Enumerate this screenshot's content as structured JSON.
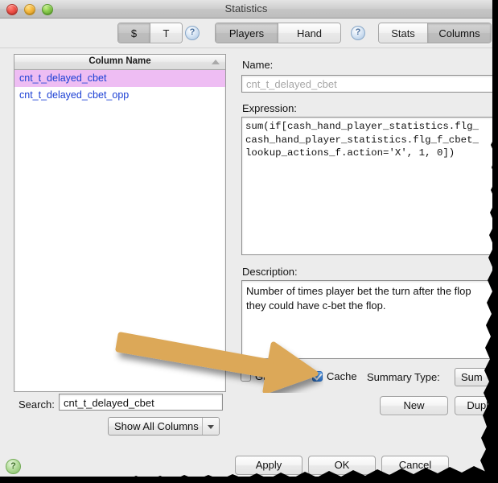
{
  "window": {
    "title": "Statistics",
    "traffic_lights": [
      "close",
      "minimize",
      "zoom"
    ]
  },
  "toolbar": {
    "currency_segment": {
      "options": [
        "$",
        "T"
      ],
      "selected": "$"
    },
    "scope_segment": {
      "options": [
        "Players",
        "Hand"
      ],
      "selected": "Players"
    },
    "view_segment": {
      "options": [
        "Stats",
        "Columns"
      ],
      "selected": "Columns"
    },
    "help_glyph": "?"
  },
  "column_list": {
    "header": "Column Name",
    "sort_direction": "ascending",
    "rows": [
      {
        "name": "cnt_t_delayed_cbet",
        "selected": true
      },
      {
        "name": "cnt_t_delayed_cbet_opp",
        "selected": false
      }
    ],
    "selection_color": "#eebdf3",
    "row_text_color": "#1b3fd4"
  },
  "search": {
    "label": "Search:",
    "value": "cnt_t_delayed_cbet",
    "placeholder": ""
  },
  "filter_popup": {
    "selected": "Show All Columns",
    "options": [
      "Show All Columns"
    ]
  },
  "detail": {
    "name_label": "Name:",
    "name_value": "cnt_t_delayed_cbet",
    "expression_label": "Expression:",
    "expression_value": "sum(if[cash_hand_player_statistics.flg_\ncash_hand_player_statistics.flg_f_cbet_\nlookup_actions_f.action='X', 1, 0])",
    "description_label": "Description:",
    "description_value": "Number of times player bet the turn after the flop\nthey could have c-bet the flop."
  },
  "options": {
    "group_by": {
      "label": "Group By",
      "checked": false
    },
    "cache": {
      "label": "Cache",
      "checked": true
    },
    "summary_type": {
      "label": "Summary Type:",
      "selected": "Sum",
      "options": [
        "Sum"
      ]
    }
  },
  "buttons": {
    "new": "New",
    "duplicate": "Duplicate",
    "apply": "Apply",
    "ok": "OK",
    "cancel": "Cancel"
  },
  "help_badge": {
    "glyph": "?"
  },
  "annotation": {
    "type": "arrow",
    "color": "#dca858",
    "points_to": "cache-checkbox",
    "direction": "right"
  }
}
